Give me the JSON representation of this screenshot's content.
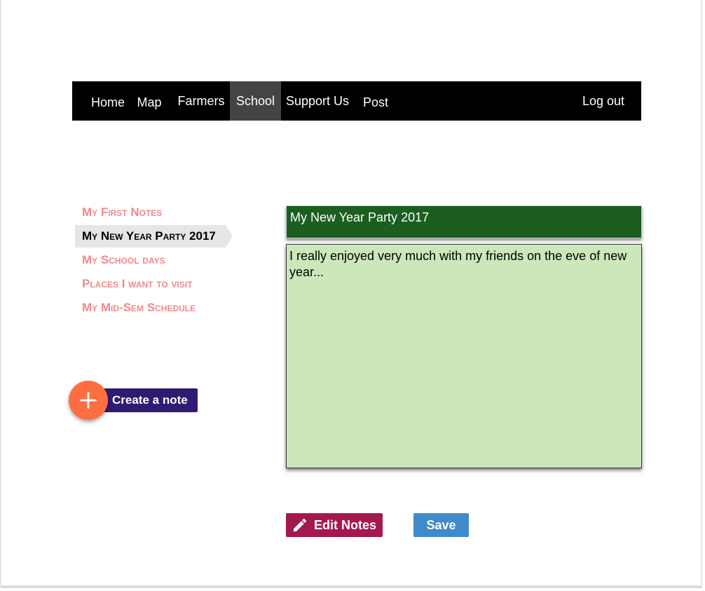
{
  "nav": {
    "items": [
      {
        "label": "Home"
      },
      {
        "label": "Map"
      },
      {
        "label": "Farmers"
      },
      {
        "label": "School",
        "active": true
      },
      {
        "label": "Support Us"
      },
      {
        "label": "Post"
      }
    ],
    "logout_label": "Log out"
  },
  "notes": {
    "items": [
      {
        "label": "My First Notes"
      },
      {
        "label": "My New Year Party 2017",
        "active": true
      },
      {
        "label": "My School days"
      },
      {
        "label": "Places I want to visit"
      },
      {
        "label": "My Mid-Sem Schedule"
      }
    ]
  },
  "create": {
    "label": "Create a note",
    "icon": "plus-icon"
  },
  "editor": {
    "title": "My New Year Party 2017",
    "body": "I really enjoyed very much with my friends on the eve of new year..."
  },
  "actions": {
    "edit_label": "Edit Notes",
    "edit_icon": "pencil-icon",
    "save_label": "Save"
  },
  "colors": {
    "navbar": "#000000",
    "nav_active": "#444444",
    "note_link": "#f08a8a",
    "fab": "#ff6e40",
    "create_label_bg": "#311b72",
    "title_bg": "#1b5e20",
    "body_bg": "#cce8bb",
    "edit_button": "#a3194f",
    "save_button": "#3f8acb"
  }
}
